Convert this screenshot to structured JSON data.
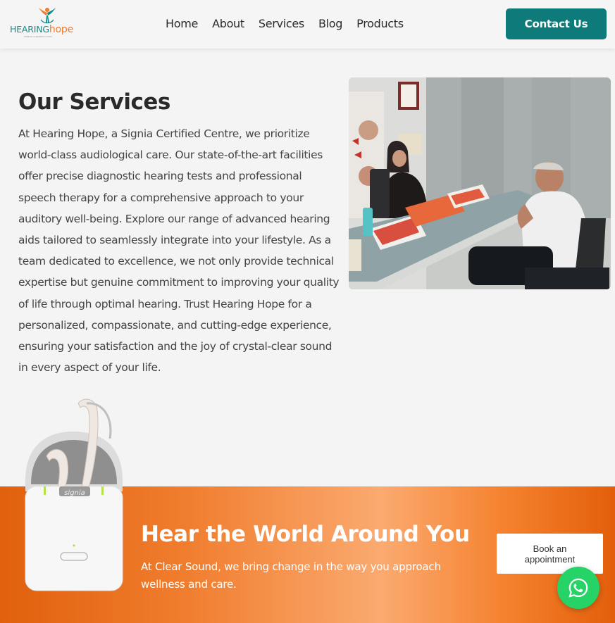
{
  "header": {
    "logo": {
      "word1": "HEARING",
      "word2": "hope",
      "tagline": "SPEECH & HEARING CLINIC"
    },
    "nav": [
      {
        "label": "Home"
      },
      {
        "label": "About"
      },
      {
        "label": "Services"
      },
      {
        "label": "Blog"
      },
      {
        "label": "Products"
      }
    ],
    "contact_label": "Contact Us"
  },
  "services": {
    "title": "Our Services",
    "body": "At Hearing Hope, a Signia Certified Centre, we prioritize world-class audiological care. Our state-of-the-art facilities offer precise diagnostic hearing tests and professional speech therapy for a comprehensive approach to your auditory well-being. Explore our range of advanced hearing aids tailored to seamlessly integrate into your lifestyle. As a team dedicated to excellence, we not only provide technical expertise but genuine commitment to improving your quality of life through optimal hearing. Trust Hearing Hope for a personalized, compassionate, and cutting-edge experience, ensuring your satisfaction and the joy of crystal-clear sound in every aspect of your life."
  },
  "banner": {
    "title": "Hear the World Around You",
    "text": "At Clear Sound, we bring change in the way you approach wellness and care.",
    "book_label": "Book an appointment",
    "device_brand": "signia"
  },
  "colors": {
    "brand_teal": "#0e7a7a",
    "brand_orange": "#f07a2d",
    "whatsapp_green": "#25d366"
  },
  "icons": {
    "whatsapp": "whatsapp-icon"
  }
}
